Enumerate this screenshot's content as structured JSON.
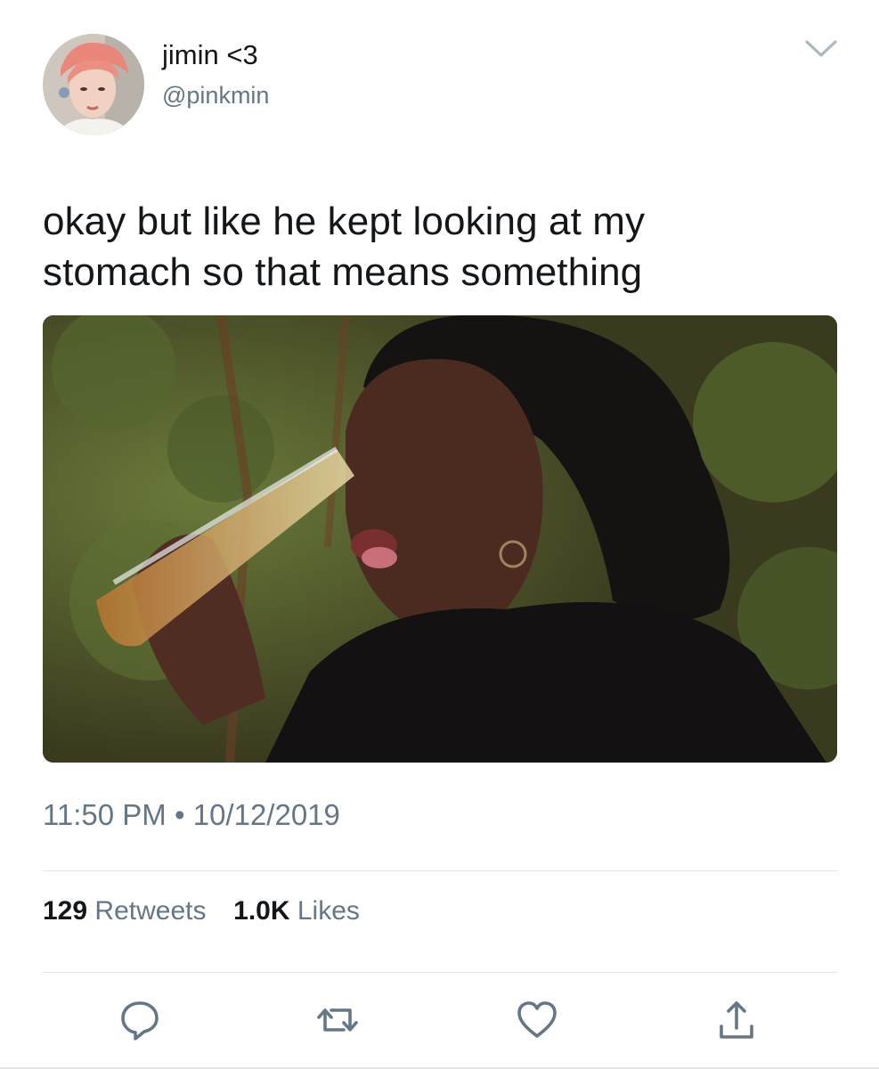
{
  "tweet": {
    "display_name": "jimin <3",
    "handle": "@pinkmin",
    "text_line1": "okay but like he kept looking at my",
    "text_line2": "stomach so that means something",
    "time": "11:50 PM",
    "separator": "•",
    "date": "10/12/2019",
    "retweets_count": "129",
    "retweets_label": "Retweets",
    "likes_count": "1.0K",
    "likes_label": "Likes"
  },
  "icons": {
    "menu": "chevron-down-icon",
    "reply": "reply-icon",
    "retweet": "retweet-icon",
    "like": "heart-icon",
    "share": "share-icon"
  },
  "colors": {
    "text_primary": "#14171a",
    "text_secondary": "#657786",
    "divider": "#e1e8ed",
    "icon": "#657786"
  }
}
